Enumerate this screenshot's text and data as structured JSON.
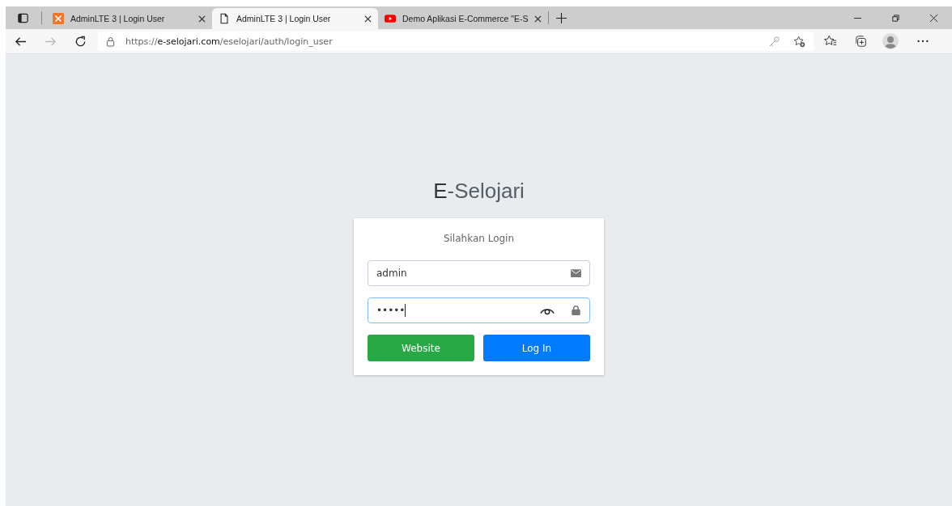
{
  "tabs": [
    {
      "title": "AdminLTE 3 | Login User",
      "selected": false
    },
    {
      "title": "AdminLTE 3 | Login User",
      "selected": true
    },
    {
      "title": "Demo Aplikasi E-Commerce \"E-S",
      "selected": false
    }
  ],
  "address_bar": {
    "scheme": "https://",
    "host": "e-selojari.com",
    "path": "/eselojari/auth/login_user"
  },
  "login": {
    "brand": "**E**-Selojari",
    "heading": "Silahkan Login",
    "fields": [
      {
        "kind": "email",
        "value": "admin",
        "focused": false
      },
      {
        "kind": "password",
        "value": "•••••",
        "focused": true
      }
    ],
    "buttons": [
      {
        "label": "Website",
        "kind": "success"
      },
      {
        "label": "Log In",
        "kind": "primary"
      }
    ]
  }
}
